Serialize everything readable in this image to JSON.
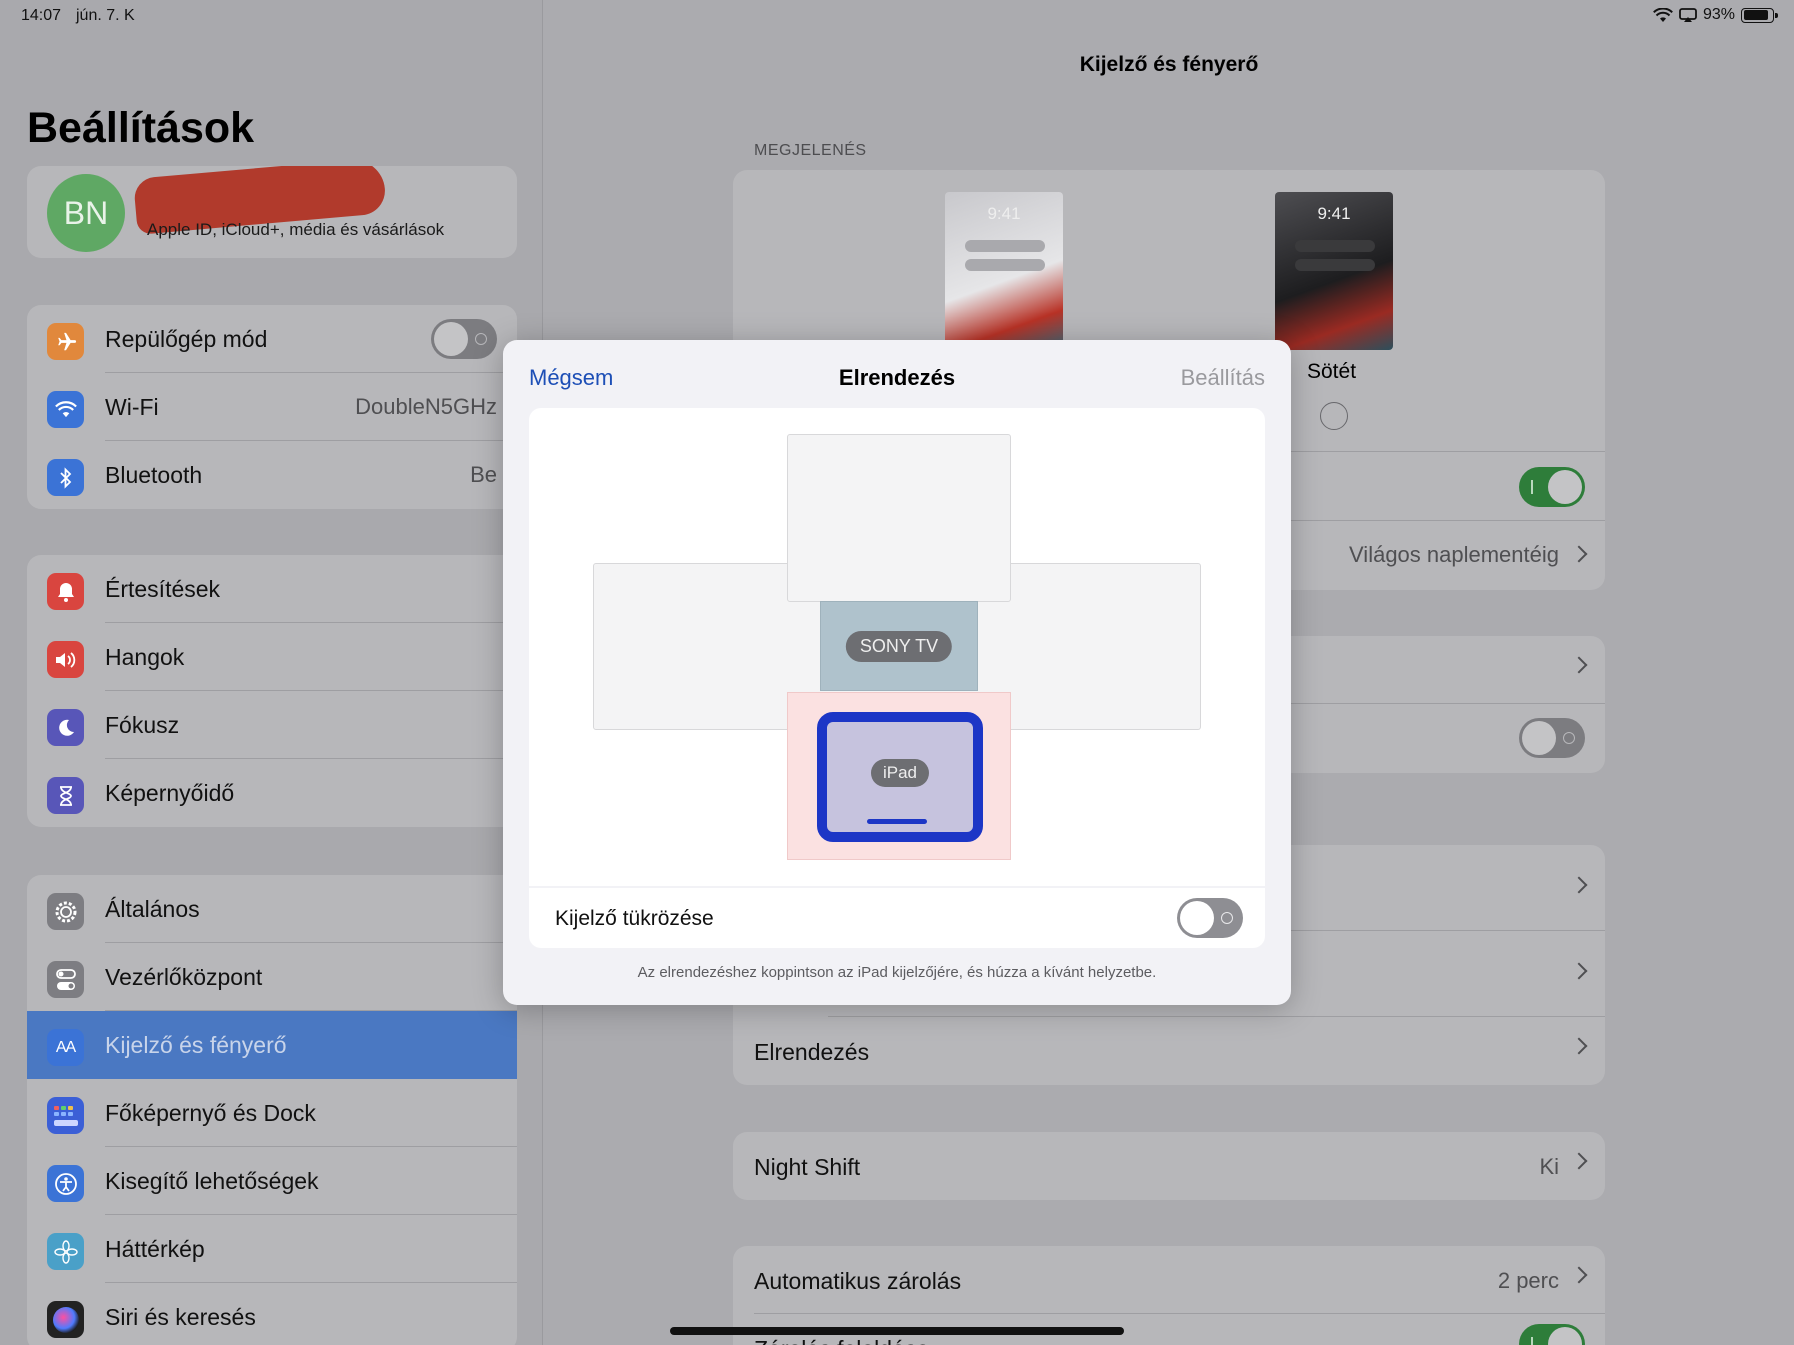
{
  "status": {
    "time": "14:07",
    "date": "jún. 7. K",
    "battery": "93%"
  },
  "sidebar": {
    "title": "Beállítások",
    "profile": {
      "initials": "BN",
      "subtitle": "Apple ID, iCloud+, média és vásárlások"
    },
    "group1": [
      {
        "label": "Repülőgép mód",
        "icon": "airplane-icon",
        "color": "#e1883c",
        "toggle": false
      },
      {
        "label": "Wi-Fi",
        "icon": "wifi-icon",
        "color": "#3b73d6",
        "value": "DoubleN5GHz"
      },
      {
        "label": "Bluetooth",
        "icon": "bluetooth-icon",
        "color": "#3b73d6",
        "value": "Be"
      }
    ],
    "group2": [
      {
        "label": "Értesítések",
        "icon": "bell-icon",
        "color": "#d9453f"
      },
      {
        "label": "Hangok",
        "icon": "speaker-icon",
        "color": "#d9453f"
      },
      {
        "label": "Fókusz",
        "icon": "moon-icon",
        "color": "#5856b8"
      },
      {
        "label": "Képernyőidő",
        "icon": "hourglass-icon",
        "color": "#5856b8"
      }
    ],
    "group3": [
      {
        "label": "Általános",
        "icon": "gear-icon",
        "color": "#7d7d82"
      },
      {
        "label": "Vezérlőközpont",
        "icon": "switches-icon",
        "color": "#7d7d82"
      },
      {
        "label": "Kijelző és fényerő",
        "icon": "text-size-icon",
        "color": "#3b73d6",
        "selected": true
      },
      {
        "label": "Főképernyő és Dock",
        "icon": "grid-icon",
        "color": "#3b5fd6"
      },
      {
        "label": "Kisegítő lehetőségek",
        "icon": "accessibility-icon",
        "color": "#3b73d6"
      },
      {
        "label": "Háttérkép",
        "icon": "flower-icon",
        "color": "#4aa0c8"
      },
      {
        "label": "Siri és keresés",
        "icon": "siri-icon",
        "color": "#222"
      }
    ]
  },
  "detail": {
    "title": "Kijelző és fényerő",
    "appearance_header": "MEGJELENÉS",
    "light_time": "9:41",
    "dark_time": "9:41",
    "dark_label": "Sötét",
    "auto_value": "Világos naplementéig",
    "layout_label": "Elrendezés",
    "night_shift": {
      "label": "Night Shift",
      "value": "Ki"
    },
    "auto_lock": {
      "label": "Automatikus zárolás",
      "value": "2 perc"
    },
    "partial_label": "Zárolás feloldása"
  },
  "modal": {
    "cancel": "Mégsem",
    "title": "Elrendezés",
    "apply": "Beállítás",
    "tv_label": "SONY TV",
    "ipad_label": "iPad",
    "mirror_label": "Kijelző tükrözése",
    "mirror_on": false,
    "hint": "Az elrendezéshez koppintson az iPad kijelzőjére, és húzza a kívánt helyzetbe."
  }
}
